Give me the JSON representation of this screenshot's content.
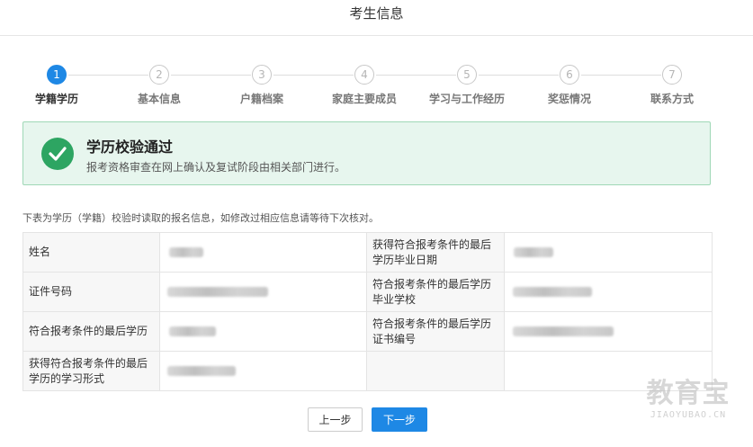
{
  "header": {
    "title": "考生信息"
  },
  "steps": [
    {
      "num": "1",
      "label": "学籍学历",
      "active": true
    },
    {
      "num": "2",
      "label": "基本信息",
      "active": false
    },
    {
      "num": "3",
      "label": "户籍档案",
      "active": false
    },
    {
      "num": "4",
      "label": "家庭主要成员",
      "active": false
    },
    {
      "num": "5",
      "label": "学习与工作经历",
      "active": false
    },
    {
      "num": "6",
      "label": "奖惩情况",
      "active": false
    },
    {
      "num": "7",
      "label": "联系方式",
      "active": false
    }
  ],
  "alert": {
    "title": "学历校验通过",
    "desc": "报考资格审查在网上确认及复试阶段由相关部门进行。",
    "icon": "check-circle-icon",
    "color": "#2da562"
  },
  "note": "下表为学历（学籍）校验时读取的报名信息，如修改过相应信息请等待下次核对。",
  "table": {
    "rows": [
      {
        "k1": "姓名",
        "k2": "获得符合报考条件的最后学历毕业日期"
      },
      {
        "k1": "证件号码",
        "k2": "符合报考条件的最后学历毕业学校"
      },
      {
        "k1": "符合报考条件的最后学历",
        "k2": "符合报考条件的最后学历证书编号"
      },
      {
        "k1": "获得符合报考条件的最后学历的学习形式",
        "k2": ""
      }
    ]
  },
  "buttons": {
    "prev": "上一步",
    "next": "下一步"
  },
  "watermark": {
    "main": "教育宝",
    "sub": "JIAOYUBAO.CN"
  },
  "colors": {
    "primary": "#1e88e5",
    "success_bg": "#e7f6ee",
    "success_border": "#9fd8b6"
  }
}
